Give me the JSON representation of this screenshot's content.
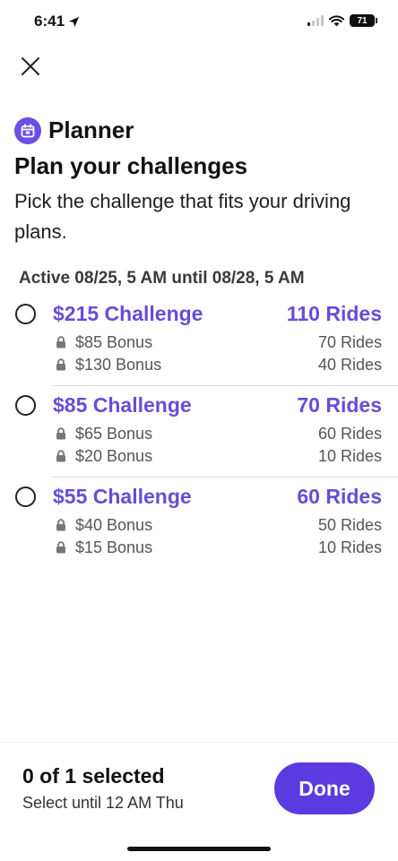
{
  "status_bar": {
    "time": "6:41",
    "battery": "71"
  },
  "header": {
    "app_label": "Planner",
    "title": "Plan your challenges",
    "subtitle": "Pick the challenge that fits your driving plans."
  },
  "active_window": "Active 08/25, 5 AM until 08/28, 5 AM",
  "challenges": [
    {
      "title": "$215 Challenge",
      "rides": "110 Rides",
      "bonuses": [
        {
          "label": "$85 Bonus",
          "rides": "70 Rides"
        },
        {
          "label": "$130 Bonus",
          "rides": "40 Rides"
        }
      ]
    },
    {
      "title": "$85 Challenge",
      "rides": "70 Rides",
      "bonuses": [
        {
          "label": "$65 Bonus",
          "rides": "60 Rides"
        },
        {
          "label": "$20 Bonus",
          "rides": "10 Rides"
        }
      ]
    },
    {
      "title": "$55 Challenge",
      "rides": "60 Rides",
      "bonuses": [
        {
          "label": "$40 Bonus",
          "rides": "50 Rides"
        },
        {
          "label": "$15 Bonus",
          "rides": "10 Rides"
        }
      ]
    }
  ],
  "footer": {
    "selected_count": "0 of 1 selected",
    "select_until": "Select until 12 AM Thu",
    "done_label": "Done"
  },
  "colors": {
    "accent": "#6a4bd8",
    "button": "#5b3be0"
  },
  "icons": {
    "close": "close-icon",
    "planner": "calendar-icon",
    "lock": "lock-icon",
    "location": "location-arrow-icon",
    "wifi": "wifi-icon",
    "signal": "cellular-signal-icon"
  }
}
